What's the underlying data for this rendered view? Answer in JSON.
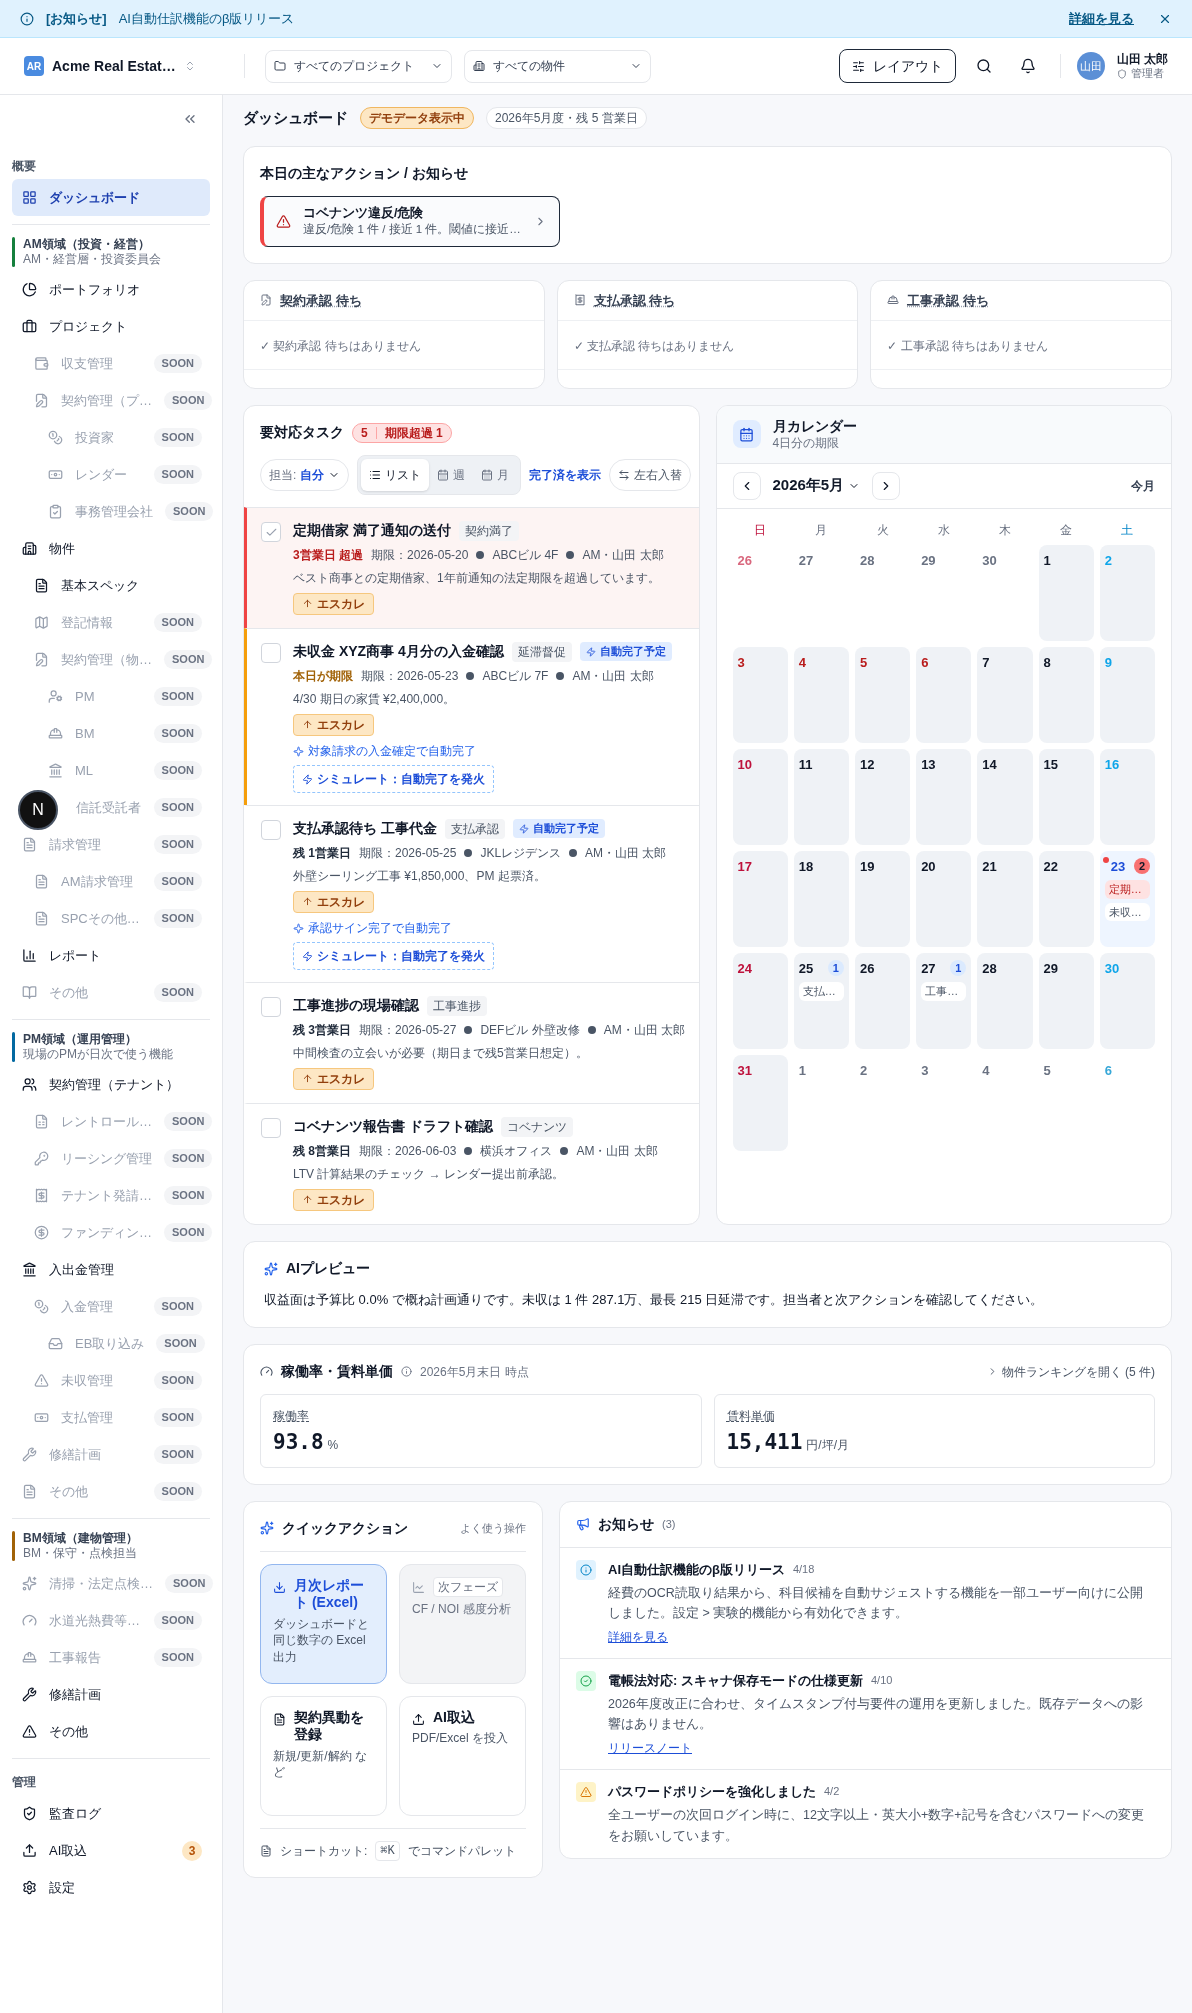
{
  "banner": {
    "label": "[お知らせ]",
    "text": "AI自動仕訳機能のβ版リリース",
    "link": "詳細を見る"
  },
  "header": {
    "logo": "AR",
    "org": "Acme Real Estat…",
    "project_select": "すべてのプロジェクト",
    "property_select": "すべての物件",
    "layout_button": "レイアウト",
    "avatar": "山田",
    "user_name": "山田 太郎",
    "user_role": "管理者"
  },
  "dev_indicator": {
    "label": "N"
  },
  "sidebar": {
    "sections": [
      {
        "title": "概要",
        "items": [
          {
            "label": "ダッシュボード",
            "selected": true,
            "disabled": false
          }
        ]
      },
      {
        "title": "AM領域（投資・経営）",
        "subtitle": "AM・経営層・投資委員会",
        "color": "#15803d",
        "items": [
          {
            "label": "ポートフォリオ",
            "selected": false,
            "disabled": false
          },
          {
            "label": "プロジェクト",
            "selected": false,
            "disabled": false,
            "children": [
              {
                "label": "収支管理",
                "badge": "SOON",
                "selected": false,
                "disabled": true
              },
              {
                "label": "契約管理（プ…",
                "badge": "SOON",
                "selected": false,
                "disabled": true,
                "children": [
                  {
                    "label": "投資家",
                    "badge": "SOON",
                    "selected": false,
                    "disabled": true
                  },
                  {
                    "label": "レンダー",
                    "badge": "SOON",
                    "selected": false,
                    "disabled": true
                  },
                  {
                    "label": "事務管理会社",
                    "badge": "SOON",
                    "selected": false,
                    "disabled": true
                  }
                ]
              }
            ]
          },
          {
            "label": "物件",
            "selected": false,
            "disabled": false,
            "children": [
              {
                "label": "基本スペック",
                "selected": false,
                "disabled": false
              },
              {
                "label": "登記情報",
                "badge": "SOON",
                "selected": false,
                "disabled": true
              },
              {
                "label": "契約管理（物…",
                "badge": "SOON",
                "selected": false,
                "disabled": true,
                "children": [
                  {
                    "label": "PM",
                    "badge": "SOON",
                    "selected": false,
                    "disabled": true
                  },
                  {
                    "label": "BM",
                    "badge": "SOON",
                    "selected": false,
                    "disabled": true
                  },
                  {
                    "label": "ML",
                    "badge": "SOON",
                    "selected": false,
                    "disabled": true
                  },
                  {
                    "label": "信託受託者",
                    "badge": "SOON",
                    "selected": false,
                    "disabled": true
                  }
                ]
              }
            ]
          },
          {
            "label": "請求管理",
            "badge": "SOON",
            "selected": false,
            "disabled": true,
            "children": [
              {
                "label": "AM請求管理",
                "badge": "SOON",
                "selected": false,
                "disabled": true
              },
              {
                "label": "SPCその他…",
                "badge": "SOON",
                "selected": false,
                "disabled": true
              }
            ]
          },
          {
            "label": "レポート",
            "selected": false,
            "disabled": false
          },
          {
            "label": "その他",
            "badge": "SOON",
            "selected": false,
            "disabled": true
          }
        ]
      },
      {
        "title": "PM領域（運用管理）",
        "subtitle": "現場のPMが日次で使う機能",
        "color": "#0369a1",
        "items": [
          {
            "label": "契約管理（テナント）",
            "selected": false,
            "disabled": false,
            "children": [
              {
                "label": "レントロール…",
                "badge": "SOON",
                "selected": false,
                "disabled": true
              },
              {
                "label": "リーシング管理",
                "badge": "SOON",
                "selected": false,
                "disabled": true
              },
              {
                "label": "テナント発請…",
                "badge": "SOON",
                "selected": false,
                "disabled": true
              },
              {
                "label": "ファンディン…",
                "badge": "SOON",
                "selected": false,
                "disabled": true
              }
            ]
          },
          {
            "label": "入出金管理",
            "selected": false,
            "disabled": false,
            "children": [
              {
                "label": "入金管理",
                "badge": "SOON",
                "selected": false,
                "disabled": true,
                "children": [
                  {
                    "label": "EB取り込み",
                    "badge": "SOON",
                    "selected": false,
                    "disabled": true
                  }
                ]
              },
              {
                "label": "未収管理",
                "badge": "SOON",
                "selected": false,
                "disabled": true
              },
              {
                "label": "支払管理",
                "badge": "SOON",
                "selected": false,
                "disabled": true
              }
            ]
          },
          {
            "label": "修繕計画",
            "badge": "SOON",
            "selected": false,
            "disabled": true
          },
          {
            "label": "その他",
            "badge": "SOON",
            "selected": false,
            "disabled": true
          }
        ]
      },
      {
        "title": "BM領域（建物管理）",
        "subtitle": "BM・保守・点検担当",
        "color": "#a16207",
        "items": [
          {
            "label": "清掃・法定点検…",
            "badge": "SOON",
            "selected": false,
            "disabled": true
          },
          {
            "label": "水道光熱費等…",
            "badge": "SOON",
            "selected": false,
            "disabled": true
          },
          {
            "label": "工事報告",
            "badge": "SOON",
            "selected": false,
            "disabled": true
          },
          {
            "label": "修繕計画",
            "selected": false,
            "disabled": false
          },
          {
            "label": "その他",
            "selected": false,
            "disabled": false
          }
        ]
      },
      {
        "title": "管理",
        "items": [
          {
            "label": "監査ログ",
            "selected": false,
            "disabled": false
          },
          {
            "label": "AI取込",
            "badge": "3",
            "selected": false,
            "disabled": false
          },
          {
            "label": "設定",
            "selected": false,
            "disabled": false
          }
        ]
      }
    ]
  },
  "page": {
    "title": "ダッシュボード",
    "demo_badge": "デモデータ表示中",
    "period": "2026年5月度・残 5 営業日"
  },
  "actions": {
    "title": "本日の主なアクション / お知らせ",
    "alerts": [
      {
        "title": "コベナンツ違反/危険",
        "text": "違反/危険 1 件 / 接近 1 件。閾値に接近…"
      }
    ]
  },
  "approvals": [
    {
      "title": "契約承認 待ち",
      "empty": "✓ 契約承認 待ちはありません"
    },
    {
      "title": "支払承認 待ち",
      "empty": "✓ 支払承認 待ちはありません"
    },
    {
      "title": "工事承認 待ち",
      "empty": "✓ 工事承認 待ちはありません"
    }
  ],
  "tasks": {
    "title": "要対応タスク",
    "count": "5",
    "overdue": "期限超過 1",
    "assignee_label": "担当:",
    "assignee": "自分",
    "views": [
      {
        "label": "リスト",
        "selected": true
      },
      {
        "label": "週",
        "selected": false
      },
      {
        "label": "月",
        "selected": false
      }
    ],
    "show_done": "完了済を表示",
    "swap": "左右入替",
    "items": [
      {
        "checked": true,
        "title": "定期借家 満了通知の送付",
        "tag": "契約満了",
        "kind": "overdue",
        "due_label": "3営業日 超過",
        "due": "期限：2026-05-20",
        "property": "ABCビル 4F",
        "assignee": "AM・山田 太郎",
        "note": "ベスト商事との定期借家、1年前通知の法定期限を超過しています。",
        "escalate": "エスカレ"
      },
      {
        "checked": false,
        "title": "未収金 XYZ商事 4月分の入金確認",
        "tag": "延滞督促",
        "auto_badge": "自動完了予定",
        "kind": "today",
        "due_label": "本日が期限",
        "due": "期限：2026-05-23",
        "property": "ABCビル 7F",
        "assignee": "AM・山田 太郎",
        "note": "4/30 期日の家賃 ¥2,400,000。",
        "escalate": "エスカレ",
        "auto_rule": "対象請求の入金確定で自動完了",
        "simulate": "シミュレート：自動完了を発火"
      },
      {
        "checked": false,
        "title": "支払承認待ち 工事代金",
        "tag": "支払承認",
        "auto_badge": "自動完了予定",
        "kind": "normal",
        "due_label": "残 1営業日",
        "due": "期限：2026-05-25",
        "property": "JKLレジデンス",
        "assignee": "AM・山田 太郎",
        "note": "外壁シーリング工事 ¥1,850,000、PM 起票済。",
        "escalate": "エスカレ",
        "auto_rule": "承認サイン完了で自動完了",
        "simulate": "シミュレート：自動完了を発火"
      },
      {
        "checked": false,
        "title": "工事進捗の現場確認",
        "tag": "工事進捗",
        "kind": "normal",
        "due_label": "残 3営業日",
        "due": "期限：2026-05-27",
        "property": "DEFビル 外壁改修",
        "assignee": "AM・山田 太郎",
        "note": "中間検査の立会いが必要（期日まで残5営業日想定）。",
        "escalate": "エスカレ"
      },
      {
        "checked": false,
        "title": "コベナンツ報告書 ドラフト確認",
        "tag": "コベナンツ",
        "kind": "normal",
        "due_label": "残 8営業日",
        "due": "期限：2026-06-03",
        "property": "横浜オフィス",
        "assignee": "AM・山田 太郎",
        "note": "LTV 計算結果のチェック → レンダー提出前承認。",
        "escalate": "エスカレ"
      }
    ]
  },
  "calendar": {
    "title": "月カレンダー",
    "subtitle": "4日分の期限",
    "month": "2026年5月",
    "today_button": "今月",
    "weekdays": [
      "日",
      "月",
      "火",
      "水",
      "木",
      "金",
      "土"
    ],
    "days": [
      {
        "label": "26",
        "in_month": false,
        "holiday": false,
        "selected": false
      },
      {
        "label": "27",
        "in_month": false,
        "holiday": false,
        "selected": false
      },
      {
        "label": "28",
        "in_month": false,
        "holiday": false,
        "selected": false
      },
      {
        "label": "29",
        "in_month": false,
        "holiday": false,
        "selected": false
      },
      {
        "label": "30",
        "in_month": false,
        "holiday": false,
        "selected": false
      },
      {
        "label": "1",
        "in_month": true,
        "holiday": false,
        "selected": false
      },
      {
        "label": "2",
        "in_month": true,
        "holiday": false,
        "selected": false
      },
      {
        "label": "3",
        "in_month": true,
        "holiday": true,
        "selected": false
      },
      {
        "label": "4",
        "in_month": true,
        "holiday": true,
        "selected": false
      },
      {
        "label": "5",
        "in_month": true,
        "holiday": true,
        "selected": false
      },
      {
        "label": "6",
        "in_month": true,
        "holiday": true,
        "selected": false
      },
      {
        "label": "7",
        "in_month": true,
        "holiday": false,
        "selected": false
      },
      {
        "label": "8",
        "in_month": true,
        "holiday": false,
        "selected": false
      },
      {
        "label": "9",
        "in_month": true,
        "holiday": false,
        "selected": false
      },
      {
        "label": "10",
        "in_month": true,
        "holiday": false,
        "selected": false
      },
      {
        "label": "11",
        "in_month": true,
        "holiday": false,
        "selected": false
      },
      {
        "label": "12",
        "in_month": true,
        "holiday": false,
        "selected": false
      },
      {
        "label": "13",
        "in_month": true,
        "holiday": false,
        "selected": false
      },
      {
        "label": "14",
        "in_month": true,
        "holiday": false,
        "selected": false
      },
      {
        "label": "15",
        "in_month": true,
        "holiday": false,
        "selected": false
      },
      {
        "label": "16",
        "in_month": true,
        "holiday": false,
        "selected": false
      },
      {
        "label": "17",
        "in_month": true,
        "holiday": false,
        "selected": false
      },
      {
        "label": "18",
        "in_month": true,
        "holiday": false,
        "selected": false
      },
      {
        "label": "19",
        "in_month": true,
        "holiday": false,
        "selected": false
      },
      {
        "label": "20",
        "in_month": true,
        "holiday": false,
        "selected": false
      },
      {
        "label": "21",
        "in_month": true,
        "holiday": false,
        "selected": false
      },
      {
        "label": "22",
        "in_month": true,
        "holiday": false,
        "selected": false
      },
      {
        "label": "23",
        "in_month": true,
        "holiday": false,
        "selected": true,
        "count": "2",
        "events": [
          {
            "label": "定期…",
            "overdue": true
          },
          {
            "label": "未収…",
            "overdue": false
          }
        ]
      },
      {
        "label": "24",
        "in_month": true,
        "holiday": false,
        "selected": false
      },
      {
        "label": "25",
        "in_month": true,
        "holiday": false,
        "selected": false,
        "count": "1",
        "events": [
          {
            "label": "支払…",
            "overdue": false
          }
        ]
      },
      {
        "label": "26",
        "in_month": true,
        "holiday": false,
        "selected": false
      },
      {
        "label": "27",
        "in_month": true,
        "holiday": false,
        "selected": false,
        "count": "1",
        "events": [
          {
            "label": "工事…",
            "overdue": false
          }
        ]
      },
      {
        "label": "28",
        "in_month": true,
        "holiday": false,
        "selected": false
      },
      {
        "label": "29",
        "in_month": true,
        "holiday": false,
        "selected": false
      },
      {
        "label": "30",
        "in_month": true,
        "holiday": false,
        "selected": false
      },
      {
        "label": "31",
        "in_month": true,
        "holiday": false,
        "selected": false
      },
      {
        "label": "1",
        "in_month": false,
        "holiday": false,
        "selected": false
      },
      {
        "label": "2",
        "in_month": false,
        "holiday": false,
        "selected": false
      },
      {
        "label": "3",
        "in_month": false,
        "holiday": false,
        "selected": false
      },
      {
        "label": "4",
        "in_month": false,
        "holiday": false,
        "selected": false
      },
      {
        "label": "5",
        "in_month": false,
        "holiday": false,
        "selected": false
      },
      {
        "label": "6",
        "in_month": false,
        "holiday": false,
        "selected": false
      }
    ]
  },
  "ai_preview": {
    "title": "AIプレビュー",
    "text": "収益面は予算比 0.0% で概ね計画通りです。未収は 1 件 287.1万、最長 215 日延滞です。担当者と次アクションを確認してください。"
  },
  "occupancy": {
    "title": "稼働率・賃料単価",
    "as_of": "2026年5月末日 時点",
    "link": "物件ランキングを開く (5 件)",
    "metrics": [
      {
        "label": "稼働率",
        "value": "93.8",
        "unit": "%"
      },
      {
        "label": "賃料単価",
        "value": "15,411",
        "unit": "円/坪/月"
      }
    ]
  },
  "quick_actions": {
    "title": "クイックアクション",
    "hint": "よく使う操作",
    "items": [
      {
        "kind": "primary",
        "title": "月次レポート (Excel)",
        "text": "ダッシュボードと同じ数字の Excel 出力",
        "disabled": false
      },
      {
        "kind": "locked",
        "badge": "次フェーズ",
        "text": "CF / NOI 感度分析",
        "disabled": true
      },
      {
        "kind": "contract",
        "title": "契約異動を登録",
        "text": "新規/更新/解約 など",
        "disabled": false
      },
      {
        "kind": "upload",
        "title": "AI取込",
        "text": "PDF/Excel を投入",
        "disabled": false
      }
    ],
    "shortcut_label": "ショートカット:",
    "shortcut_key": "⌘K",
    "shortcut_text": "でコマンドパレット"
  },
  "news": {
    "title": "お知らせ",
    "count": "(3)",
    "items": [
      {
        "kind": "info",
        "title": "AI自動仕訳機能のβ版リリース",
        "date": "4/18",
        "text": "経費のOCR読取り結果から、科目候補を自動サジェストする機能を一部ユーザー向けに公開しました。設定 > 実験的機能から有効化できます。",
        "link": "詳細を見る"
      },
      {
        "kind": "success",
        "title": "電帳法対応: スキャナ保存モードの仕様更新",
        "date": "4/10",
        "text": "2026年度改正に合わせ、タイムスタンプ付与要件の運用を更新しました。既存データへの影響はありません。",
        "link": "リリースノート"
      },
      {
        "kind": "warning",
        "title": "パスワードポリシーを強化しました",
        "date": "4/2",
        "text": "全ユーザーの次回ログイン時に、12文字以上・英大小+数字+記号を含むパスワードへの変更をお願いしています。"
      }
    ]
  }
}
